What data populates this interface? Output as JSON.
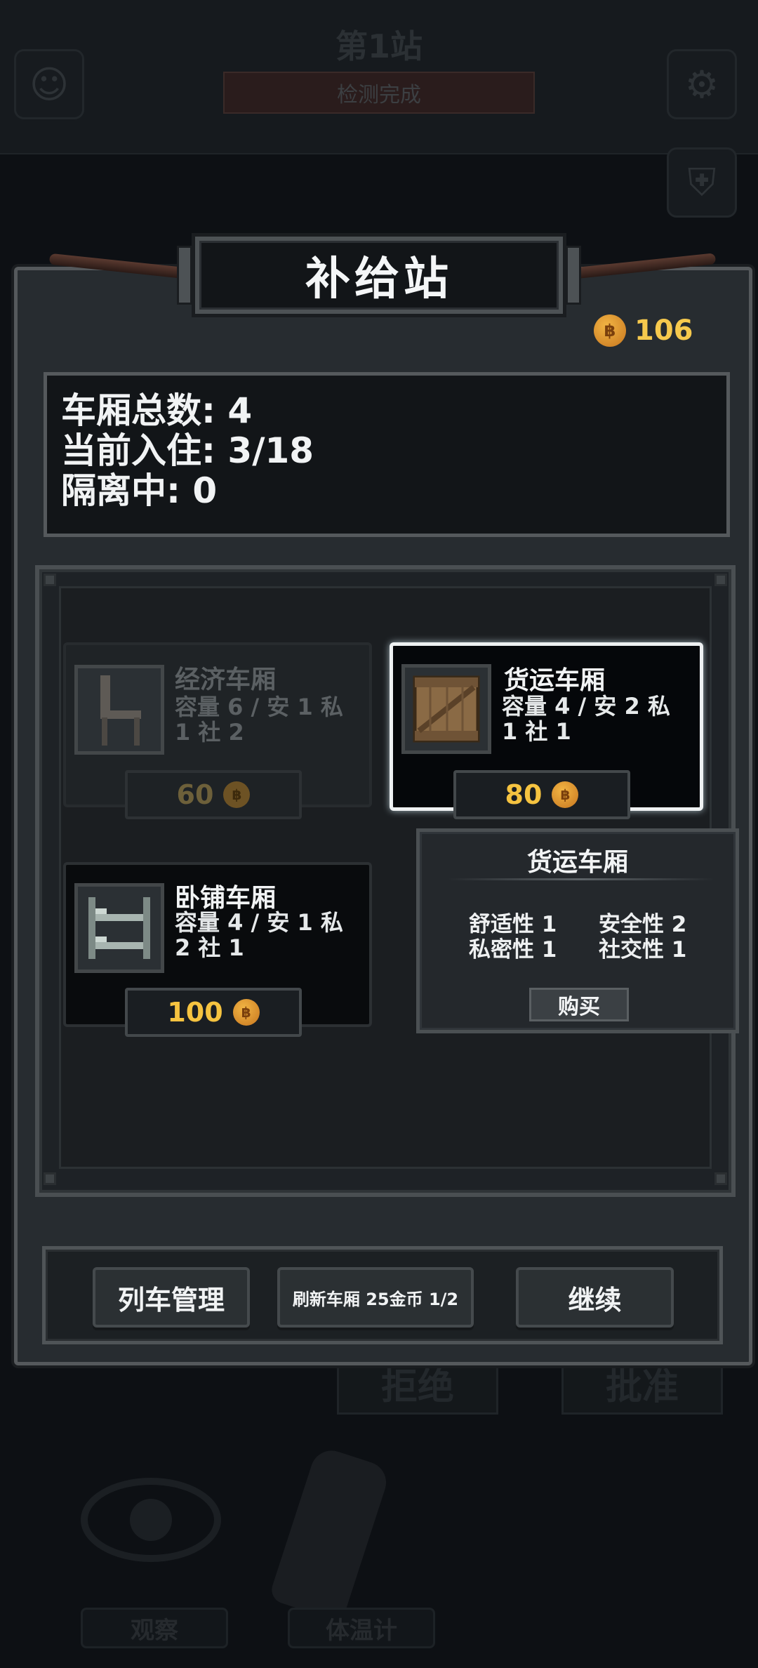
{
  "background": {
    "station_title": "第1站",
    "station_status": "检测完成",
    "reject_label": "拒绝",
    "approve_label": "批准",
    "observe_label": "观察",
    "thermometer_label": "体温计"
  },
  "panel": {
    "title": "补给站",
    "coins": "106"
  },
  "stats": {
    "total_carriages": "车厢总数: 4",
    "current_occupancy": "当前入住: 3/18",
    "quarantine": "隔离中: 0"
  },
  "cards": [
    {
      "name": "经济车厢",
      "desc_line1": "容量 6 / 安 1 私",
      "desc_line2": "1 社 2",
      "price": "60",
      "state": "disabled",
      "icon": "chair-icon"
    },
    {
      "name": "货运车厢",
      "desc_line1": "容量 4 / 安 2 私",
      "desc_line2": "1 社 1",
      "price": "80",
      "state": "selected",
      "icon": "crate-icon"
    },
    {
      "name": "卧铺车厢",
      "desc_line1": "容量 4 / 安 1 私",
      "desc_line2": "2 社 1",
      "price": "100",
      "state": "available",
      "icon": "bunk-bed-icon"
    }
  ],
  "detail": {
    "title": "货运车厢",
    "comfort": "舒适性 1",
    "safety": "安全性 2",
    "privacy": "私密性 1",
    "social": "社交性 1",
    "buy_label": "购买"
  },
  "buttons": {
    "train_manage": "列车管理",
    "refresh": "刷新车厢 25金币 1/2",
    "continue": "继续"
  },
  "colors": {
    "coin_gold": "#f5c340",
    "panel_bg": "#272c30",
    "frame": "#55595c"
  }
}
